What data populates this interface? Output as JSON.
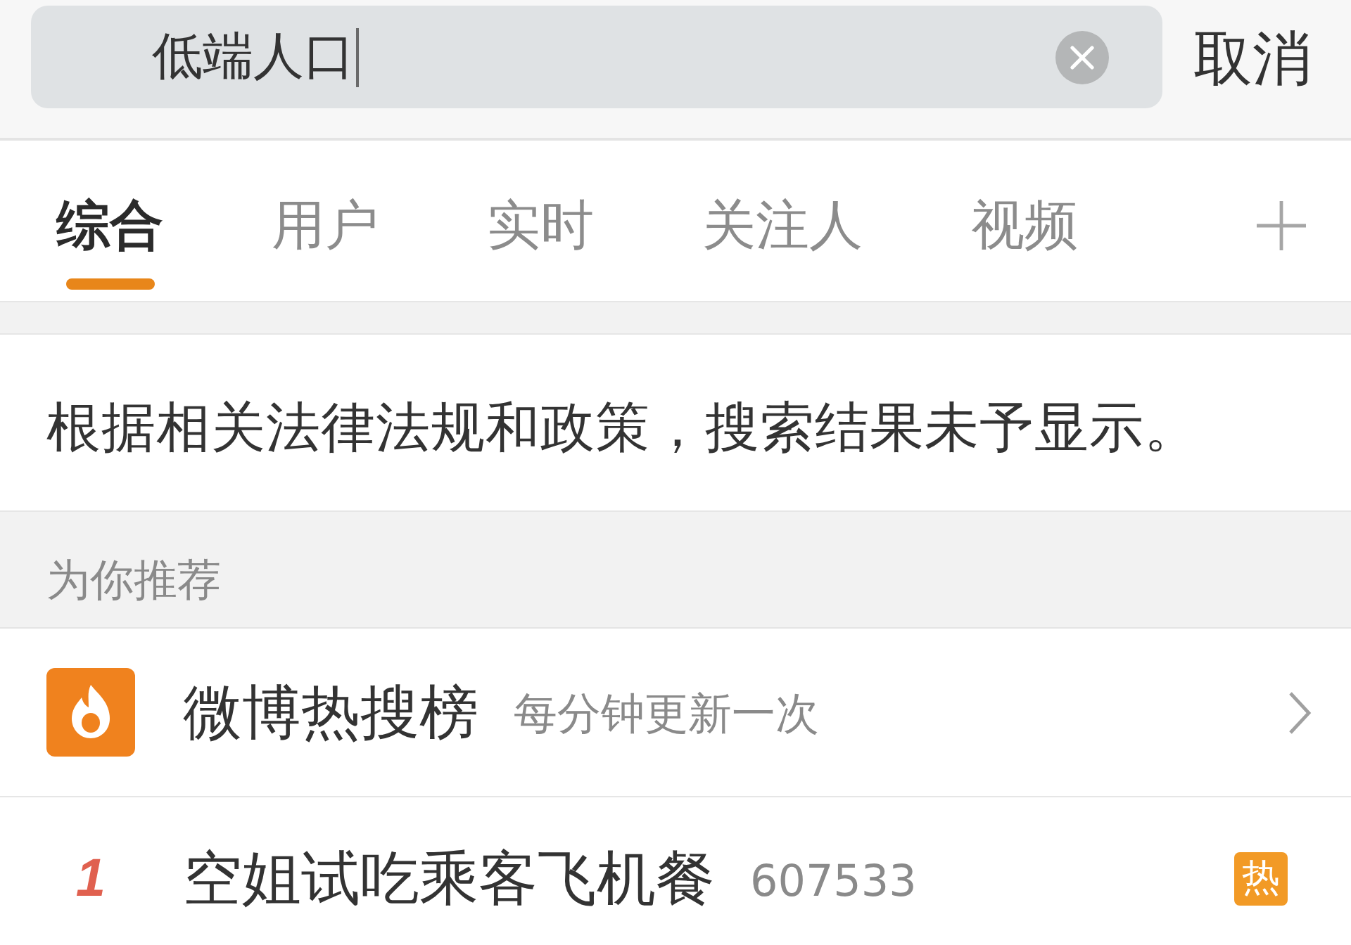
{
  "search": {
    "value": "低端人口",
    "cancel": "取消"
  },
  "tabs": [
    {
      "label": "综合",
      "selected": true
    },
    {
      "label": "用户",
      "selected": false
    },
    {
      "label": "实时",
      "selected": false
    },
    {
      "label": "关注人",
      "selected": false
    },
    {
      "label": "视频",
      "selected": false
    }
  ],
  "notice": "根据相关法律法规和政策，搜索结果未予显示。",
  "section_title": "为你推荐",
  "hot_search": {
    "title": "微博热搜榜",
    "subtitle": "每分钟更新一次"
  },
  "hot_items": [
    {
      "rank": "1",
      "title": "空姐试吃乘客飞机餐",
      "count": "607533",
      "badge": "热"
    }
  ]
}
